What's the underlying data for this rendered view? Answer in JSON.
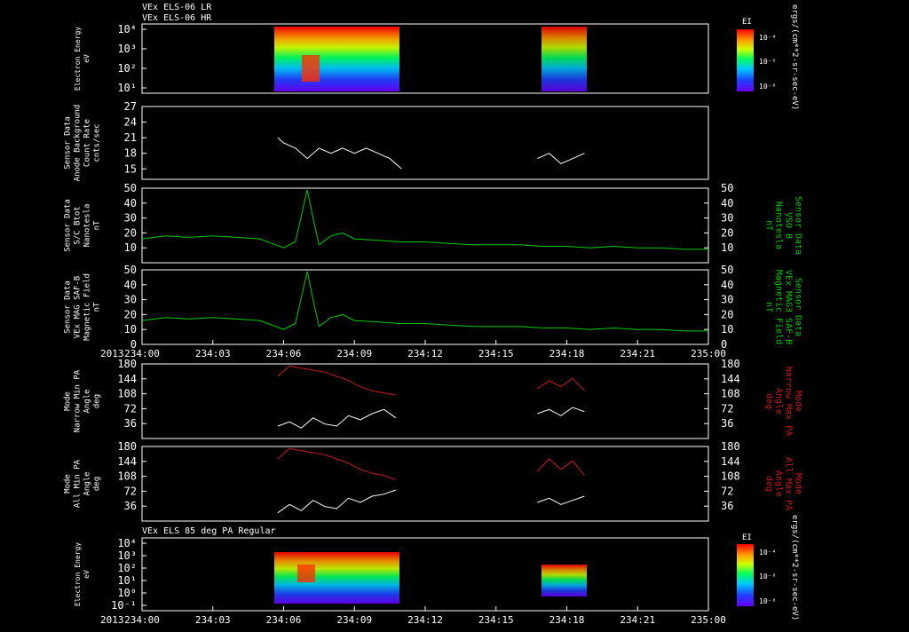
{
  "header": {
    "line1": "VEx ELS-06 LR",
    "line2": "VEx ELS-06 HR",
    "panel7_title": "VEx ELS 85 deg PA Regular"
  },
  "year_label": "2013",
  "time_ticks": [
    "234:00",
    "234:03",
    "234:06",
    "234:09",
    "234:12",
    "234:15",
    "234:18",
    "234:21",
    "235:00"
  ],
  "colors": {
    "white": "#ffffff",
    "green": "#00cc00",
    "red": "#cc1a1a",
    "background": "#000000"
  },
  "colorbar": {
    "title": "EI",
    "tick_labels": [
      "10⁻⁴",
      "10⁻⁶",
      "10⁻⁸"
    ],
    "units": "ergs/(cm**2-sr-sec-eV)"
  },
  "chart_data": [
    {
      "type": "heatmap",
      "panel": "electron_energy_top",
      "ylabel": [
        "Electron Energy",
        "eV"
      ],
      "yticks": [
        "10⁴",
        "10³",
        "10²",
        "10¹"
      ],
      "yscale": "log",
      "data_intervals": [
        [
          "234:05:45",
          "234:11:00"
        ],
        [
          "234:16:45",
          "234:18:45"
        ]
      ]
    },
    {
      "type": "line",
      "panel": "sensor_background",
      "ylabel": [
        "Sensor Data",
        "Anode Background",
        "Count Rate",
        "cnts/sec"
      ],
      "ylim": [
        13,
        27
      ],
      "yticks": [
        "27",
        "24",
        "21",
        "18",
        "15"
      ],
      "series": [
        {
          "color": "white",
          "segments": [
            {
              "x": [
                "234:05:45",
                "234:06:00",
                "234:06:30",
                "234:07:00",
                "234:07:30",
                "234:08:00",
                "234:08:30",
                "234:09:00",
                "234:09:30",
                "234:10:00",
                "234:10:30",
                "234:11:00"
              ],
              "y": [
                21,
                20,
                19,
                17,
                19,
                18,
                19,
                18,
                19,
                18,
                17,
                15
              ]
            },
            {
              "x": [
                "234:16:45",
                "234:17:15",
                "234:17:45",
                "234:18:15",
                "234:18:45"
              ],
              "y": [
                17,
                18,
                16,
                17,
                18
              ]
            }
          ]
        }
      ]
    },
    {
      "type": "line",
      "panel": "bmag_scaled",
      "ylabel": [
        "Sensor Data",
        "S/C Btot",
        "Nanotesla",
        "nT"
      ],
      "ylabel_right": [
        "Sensor Data",
        "VSO B",
        "Nanotesla",
        "nT"
      ],
      "ylim": [
        0,
        50
      ],
      "yticks": [
        "50",
        "40",
        "30",
        "20",
        "10"
      ],
      "series": [
        {
          "color": "green",
          "x": [
            "234:00",
            "234:01",
            "234:02",
            "234:03",
            "234:04",
            "234:05",
            "234:06",
            "234:06:30",
            "234:07",
            "234:07:15",
            "234:07:30",
            "234:08",
            "234:08:30",
            "234:09",
            "234:10",
            "234:11",
            "234:12",
            "234:13",
            "234:14",
            "234:15",
            "234:16",
            "234:17",
            "234:18",
            "234:19",
            "234:20",
            "234:21",
            "234:22",
            "234:23",
            "234:24",
            "235:00"
          ],
          "y": [
            16,
            18,
            17,
            18,
            17,
            16,
            10,
            14,
            49,
            30,
            12,
            18,
            20,
            16,
            15,
            14,
            14,
            13,
            12,
            12,
            12,
            11,
            11,
            10,
            11,
            10,
            10,
            9,
            9,
            9
          ]
        }
      ]
    },
    {
      "type": "line",
      "panel": "bmag_saf",
      "ylabel": [
        "Sensor Data",
        "VEx MAG SAF-B",
        "Magnetic Field",
        "nT"
      ],
      "ylabel_right": [
        "Sensor Data",
        "VEx MAG3 SAF-B",
        "Magnetic Field",
        "nT"
      ],
      "ylim": [
        0,
        50
      ],
      "yticks": [
        "50",
        "40",
        "30",
        "20",
        "10",
        "0"
      ],
      "series": [
        {
          "color": "green",
          "x": [
            "234:00",
            "234:01",
            "234:02",
            "234:03",
            "234:04",
            "234:05",
            "234:06",
            "234:06:30",
            "234:07",
            "234:07:15",
            "234:07:30",
            "234:08",
            "234:08:30",
            "234:09",
            "234:10",
            "234:11",
            "234:12",
            "234:13",
            "234:14",
            "234:15",
            "234:16",
            "234:17",
            "234:18",
            "234:19",
            "234:20",
            "234:21",
            "234:22",
            "234:23",
            "234:24",
            "235:00"
          ],
          "y": [
            16,
            18,
            17,
            18,
            17,
            16,
            10,
            14,
            49,
            30,
            12,
            18,
            20,
            16,
            15,
            14,
            14,
            13,
            12,
            12,
            12,
            11,
            11,
            10,
            11,
            10,
            10,
            9,
            9,
            9
          ]
        }
      ]
    },
    {
      "type": "line",
      "panel": "narrow_pa",
      "ylabel": [
        "Mode",
        "Narrow Min PA",
        "Angle",
        "deg"
      ],
      "ylabel_right": [
        "Mode",
        "Narrow Max PA",
        "Angle",
        "deg"
      ],
      "ylim": [
        0,
        180
      ],
      "yticks": [
        "180",
        "144",
        "108",
        "72",
        "36"
      ],
      "series": [
        {
          "name": "Narrow Min PA",
          "color": "white",
          "segments": [
            {
              "x": [
                "234:05:45",
                "234:06:15",
                "234:06:45",
                "234:07:15",
                "234:07:45",
                "234:08:15",
                "234:08:45",
                "234:09:15",
                "234:09:45",
                "234:10:15",
                "234:10:45"
              ],
              "y": [
                30,
                40,
                25,
                50,
                35,
                30,
                55,
                45,
                60,
                70,
                50
              ]
            },
            {
              "x": [
                "234:16:45",
                "234:17:15",
                "234:17:45",
                "234:18:15",
                "234:18:45"
              ],
              "y": [
                60,
                70,
                55,
                75,
                65
              ]
            }
          ]
        },
        {
          "name": "Narrow Max PA",
          "color": "red",
          "segments": [
            {
              "x": [
                "234:05:45",
                "234:06:15",
                "234:06:45",
                "234:07:15",
                "234:07:45",
                "234:08:15",
                "234:08:45",
                "234:09:15",
                "234:09:45",
                "234:10:15",
                "234:10:45"
              ],
              "y": [
                150,
                175,
                170,
                165,
                160,
                150,
                140,
                125,
                115,
                110,
                105
              ]
            },
            {
              "x": [
                "234:16:45",
                "234:17:15",
                "234:17:45",
                "234:18:15",
                "234:18:45"
              ],
              "y": [
                120,
                140,
                125,
                145,
                115
              ]
            }
          ]
        }
      ]
    },
    {
      "type": "line",
      "panel": "all_pa",
      "ylabel": [
        "Mode",
        "All Min PA",
        "Angle",
        "deg"
      ],
      "ylabel_right": [
        "Mode",
        "All Max PA",
        "Angle",
        "deg"
      ],
      "ylim": [
        0,
        180
      ],
      "yticks": [
        "180",
        "144",
        "108",
        "72",
        "36"
      ],
      "series": [
        {
          "name": "All Min PA",
          "color": "white",
          "segments": [
            {
              "x": [
                "234:05:45",
                "234:06:15",
                "234:06:45",
                "234:07:15",
                "234:07:45",
                "234:08:15",
                "234:08:45",
                "234:09:15",
                "234:09:45",
                "234:10:15",
                "234:10:45"
              ],
              "y": [
                20,
                40,
                25,
                50,
                35,
                30,
                55,
                45,
                60,
                65,
                75
              ]
            },
            {
              "x": [
                "234:16:45",
                "234:17:15",
                "234:17:45",
                "234:18:15",
                "234:18:45"
              ],
              "y": [
                45,
                55,
                40,
                50,
                60
              ]
            }
          ]
        },
        {
          "name": "All Max PA",
          "color": "red",
          "segments": [
            {
              "x": [
                "234:05:45",
                "234:06:15",
                "234:06:45",
                "234:07:15",
                "234:07:45",
                "234:08:15",
                "234:08:45",
                "234:09:15",
                "234:09:45",
                "234:10:15",
                "234:10:45"
              ],
              "y": [
                150,
                175,
                170,
                165,
                160,
                150,
                140,
                125,
                115,
                110,
                100
              ]
            },
            {
              "x": [
                "234:16:45",
                "234:17:15",
                "234:17:45",
                "234:18:15",
                "234:18:45"
              ],
              "y": [
                120,
                150,
                125,
                145,
                110
              ]
            }
          ]
        }
      ]
    },
    {
      "type": "heatmap",
      "panel": "electron_energy_85pa",
      "ylabel": [
        "Electron Energy",
        "eV"
      ],
      "yticks": [
        "10⁴",
        "10³",
        "10²",
        "10¹",
        "10⁰",
        "10⁻¹"
      ],
      "yscale": "log",
      "data_intervals": [
        [
          "234:05:45",
          "234:11:00"
        ],
        [
          "234:16:45",
          "234:18:45"
        ]
      ]
    }
  ]
}
